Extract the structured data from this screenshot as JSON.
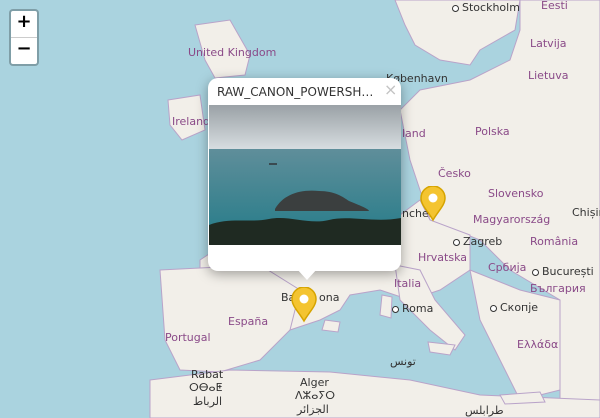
{
  "map": {
    "zoom_in_label": "+",
    "zoom_out_label": "−",
    "labels": [
      {
        "key": "stockholm",
        "text": "Stockholm",
        "kind": "city"
      },
      {
        "key": "eesti",
        "text": "Eesti",
        "kind": "country"
      },
      {
        "key": "latvija",
        "text": "Latvija",
        "kind": "country"
      },
      {
        "key": "lietuva",
        "text": "Lietuva",
        "kind": "country"
      },
      {
        "key": "united_kingdom",
        "text": "United Kingdom",
        "kind": "country"
      },
      {
        "key": "ireland",
        "text": "Ireland",
        "kind": "country"
      },
      {
        "key": "kobenhavn",
        "text": "København",
        "kind": "city"
      },
      {
        "key": "land",
        "text": "land",
        "kind": "country"
      },
      {
        "key": "polska",
        "text": "Polska",
        "kind": "country"
      },
      {
        "key": "cesko",
        "text": "Česko",
        "kind": "country"
      },
      {
        "key": "slovensko",
        "text": "Slovensko",
        "kind": "country"
      },
      {
        "key": "nchen",
        "text": "nchen",
        "kind": "city"
      },
      {
        "key": "magyarorszag",
        "text": "Magyarország",
        "kind": "country"
      },
      {
        "key": "chisinau",
        "text": "Chișin",
        "kind": "city"
      },
      {
        "key": "zagreb",
        "text": "Zagreb",
        "kind": "city"
      },
      {
        "key": "hrvatska",
        "text": "Hrvatska",
        "kind": "country"
      },
      {
        "key": "romania",
        "text": "România",
        "kind": "country"
      },
      {
        "key": "srbija",
        "text": "Србија",
        "kind": "country"
      },
      {
        "key": "bucuresti",
        "text": "București",
        "kind": "city"
      },
      {
        "key": "bulgaria",
        "text": "България",
        "kind": "country"
      },
      {
        "key": "italia",
        "text": "Italia",
        "kind": "country"
      },
      {
        "key": "espana",
        "text": "España",
        "kind": "country"
      },
      {
        "key": "portugal",
        "text": "Portugal",
        "kind": "country"
      },
      {
        "key": "roma",
        "text": "Roma",
        "kind": "city"
      },
      {
        "key": "skopje",
        "text": "Скопје",
        "kind": "city"
      },
      {
        "key": "ellada",
        "text": "Ελλάδα",
        "kind": "country"
      },
      {
        "key": "ba",
        "text": "Ba",
        "kind": "city"
      },
      {
        "key": "ona",
        "text": "ona",
        "kind": "city"
      },
      {
        "key": "tunis",
        "text": "تونس",
        "kind": "city"
      },
      {
        "key": "rabat",
        "text": "Rabat",
        "kind": "city"
      },
      {
        "key": "rabat_tif",
        "text": "ⵔⴱⴰⵟ",
        "kind": "city"
      },
      {
        "key": "rabat_ar",
        "text": "الرباط",
        "kind": "city"
      },
      {
        "key": "alger",
        "text": "Alger",
        "kind": "city"
      },
      {
        "key": "alger_tif",
        "text": "ⴷⵣⴰⵢⵔ",
        "kind": "city"
      },
      {
        "key": "alger_ar",
        "text": "الجزائر",
        "kind": "city"
      },
      {
        "key": "tarabulus",
        "text": "طرابلس",
        "kind": "city"
      }
    ]
  },
  "popup": {
    "title": "RAW_CANON_POWERSHO…",
    "close_label": "×"
  },
  "colors": {
    "water": "#aad3df",
    "land": "#f2efe9",
    "border": "#b9a3c9",
    "marker": "#f4c430",
    "marker_stroke": "#d6a400"
  }
}
